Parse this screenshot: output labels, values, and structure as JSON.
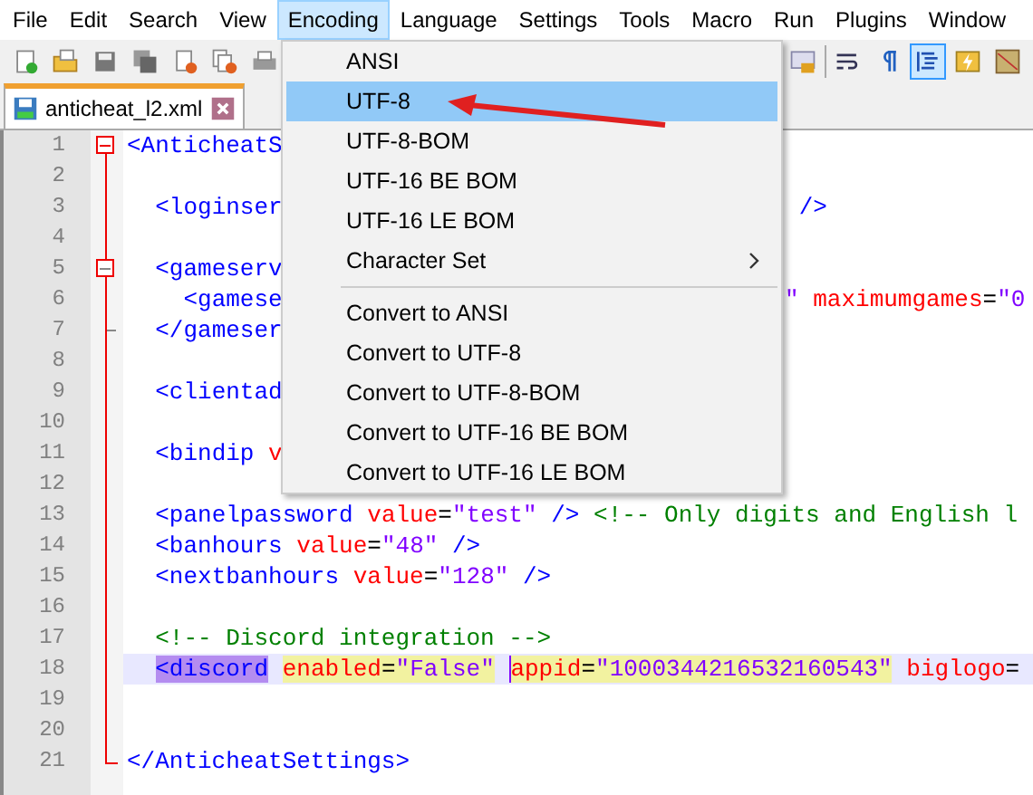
{
  "menu_bar": [
    {
      "label": "File",
      "selected": false
    },
    {
      "label": "Edit",
      "selected": false
    },
    {
      "label": "Search",
      "selected": false
    },
    {
      "label": "View",
      "selected": false
    },
    {
      "label": "Encoding",
      "selected": true
    },
    {
      "label": "Language",
      "selected": false
    },
    {
      "label": "Settings",
      "selected": false
    },
    {
      "label": "Tools",
      "selected": false
    },
    {
      "label": "Macro",
      "selected": false
    },
    {
      "label": "Run",
      "selected": false
    },
    {
      "label": "Plugins",
      "selected": false
    },
    {
      "label": "Window",
      "selected": false
    }
  ],
  "toolbar": {
    "left": [
      {
        "kind": "new",
        "selected": false
      },
      {
        "kind": "open",
        "selected": false
      },
      {
        "kind": "save",
        "selected": false
      },
      {
        "kind": "save-all",
        "selected": false
      },
      {
        "kind": "close",
        "selected": false
      },
      {
        "kind": "close-all",
        "selected": false
      },
      {
        "kind": "print",
        "selected": false
      }
    ],
    "right": [
      {
        "kind": "lock",
        "selected": false
      },
      {
        "kind": "wrap",
        "selected": false
      },
      {
        "kind": "pilcrow",
        "selected": false
      },
      {
        "kind": "indent",
        "selected": true
      },
      {
        "kind": "bolt",
        "selected": false
      },
      {
        "kind": "map",
        "selected": false
      }
    ]
  },
  "tabs": [
    {
      "label": "anticheat_l2.xml",
      "selected": true
    }
  ],
  "editor": {
    "lines": [
      {
        "number": "1",
        "kind": "fold-start",
        "current": false,
        "left": [
          {
            "kind": "tag",
            "text": "<AnticheatS"
          }
        ]
      },
      {
        "number": "2",
        "kind": "fold-body",
        "current": false
      },
      {
        "number": "3",
        "kind": "fold-body",
        "current": false,
        "left": [
          {
            "kind": "tag",
            "text": "  <loginser"
          }
        ],
        "right": [
          {
            "kind": "tag",
            "text": " />"
          }
        ]
      },
      {
        "number": "4",
        "kind": "fold-body",
        "current": false
      },
      {
        "number": "5",
        "kind": "fold-inner-start",
        "current": false,
        "left": [
          {
            "kind": "tag",
            "text": "  <gameserv"
          }
        ]
      },
      {
        "number": "6",
        "kind": "fold-body",
        "current": false,
        "left": [
          {
            "kind": "tag",
            "text": "    <gamese"
          }
        ],
        "right": [
          {
            "kind": "value",
            "text": "\""
          },
          {
            "kind": "attr",
            "text": " maximumgames"
          },
          {
            "kind": "text",
            "text": "="
          },
          {
            "kind": "value",
            "text": "\"0"
          }
        ]
      },
      {
        "number": "7",
        "kind": "fold-inner-end",
        "current": false,
        "left": [
          {
            "kind": "tag",
            "text": "  </gameser"
          }
        ]
      },
      {
        "number": "8",
        "kind": "fold-body",
        "current": false
      },
      {
        "number": "9",
        "kind": "fold-body",
        "current": false,
        "left": [
          {
            "kind": "tag",
            "text": "  <clientad"
          }
        ]
      },
      {
        "number": "10",
        "kind": "fold-body",
        "current": false
      },
      {
        "number": "11",
        "kind": "fold-body",
        "current": false,
        "left": [
          {
            "kind": "tag",
            "text": "  <bindip"
          },
          {
            "kind": "attr",
            "text": " v"
          }
        ]
      },
      {
        "number": "12",
        "kind": "fold-body",
        "current": false
      },
      {
        "number": "13",
        "kind": "fold-body",
        "current": false,
        "left": [
          {
            "kind": "tag",
            "text": "  <panelpassword"
          },
          {
            "kind": "attr",
            "text": " value"
          },
          {
            "kind": "text",
            "text": "="
          },
          {
            "kind": "value",
            "text": "\"test\""
          },
          {
            "kind": "tag",
            "text": " />"
          },
          {
            "kind": "comment",
            "text": " <!-- Only digits and English l"
          }
        ]
      },
      {
        "number": "14",
        "kind": "fold-body",
        "current": false,
        "left": [
          {
            "kind": "tag",
            "text": "  <banhours"
          },
          {
            "kind": "attr",
            "text": " value"
          },
          {
            "kind": "text",
            "text": "="
          },
          {
            "kind": "value",
            "text": "\"48\""
          },
          {
            "kind": "tag",
            "text": " />"
          }
        ]
      },
      {
        "number": "15",
        "kind": "fold-body",
        "current": false,
        "left": [
          {
            "kind": "tag",
            "text": "  <nextbanhours"
          },
          {
            "kind": "attr",
            "text": " value"
          },
          {
            "kind": "text",
            "text": "="
          },
          {
            "kind": "value",
            "text": "\"128\""
          },
          {
            "kind": "tag",
            "text": " />"
          }
        ]
      },
      {
        "number": "16",
        "kind": "fold-body",
        "current": false
      },
      {
        "number": "17",
        "kind": "fold-body",
        "current": false,
        "left": [
          {
            "kind": "comment",
            "text": "  <!-- Discord integration -->"
          }
        ]
      },
      {
        "number": "18",
        "kind": "fold-body",
        "current": true,
        "left": [
          {
            "kind": "tag-match",
            "text": "  <discord"
          },
          {
            "kind": "attr-hl",
            "text": " enabled"
          },
          {
            "kind": "text-hl",
            "text": "="
          },
          {
            "kind": "value-hl",
            "text": "\"False\" "
          },
          {
            "kind": "caret"
          },
          {
            "kind": "attr-hl",
            "text": "appid"
          },
          {
            "kind": "text-hl",
            "text": "="
          },
          {
            "kind": "value-hl",
            "text": "\"1000344216532160543\""
          },
          {
            "kind": "attr",
            "text": " biglogo"
          },
          {
            "kind": "text",
            "text": "="
          }
        ]
      },
      {
        "number": "19",
        "kind": "fold-body",
        "current": false
      },
      {
        "number": "20",
        "kind": "fold-body",
        "current": false
      },
      {
        "number": "21",
        "kind": "fold-end",
        "current": false,
        "left": [
          {
            "kind": "tag",
            "text": "</AnticheatSettings>"
          }
        ]
      }
    ]
  },
  "encoding_menu": {
    "items": [
      {
        "kind": "item",
        "label": "ANSI",
        "selected": false
      },
      {
        "kind": "item",
        "label": "UTF-8",
        "selected": true
      },
      {
        "kind": "item",
        "label": "UTF-8-BOM",
        "selected": false
      },
      {
        "kind": "item",
        "label": "UTF-16 BE BOM",
        "selected": false
      },
      {
        "kind": "item",
        "label": "UTF-16 LE BOM",
        "selected": false
      },
      {
        "kind": "submenu",
        "label": "Character Set",
        "selected": false
      },
      {
        "kind": "separator"
      },
      {
        "kind": "item",
        "label": "Convert to ANSI",
        "selected": false
      },
      {
        "kind": "item",
        "label": "Convert to UTF-8",
        "selected": false
      },
      {
        "kind": "item",
        "label": "Convert to UTF-8-BOM",
        "selected": false
      },
      {
        "kind": "item",
        "label": "Convert to UTF-16 BE BOM",
        "selected": false
      },
      {
        "kind": "item",
        "label": "Convert to UTF-16 LE BOM",
        "selected": false
      }
    ]
  }
}
